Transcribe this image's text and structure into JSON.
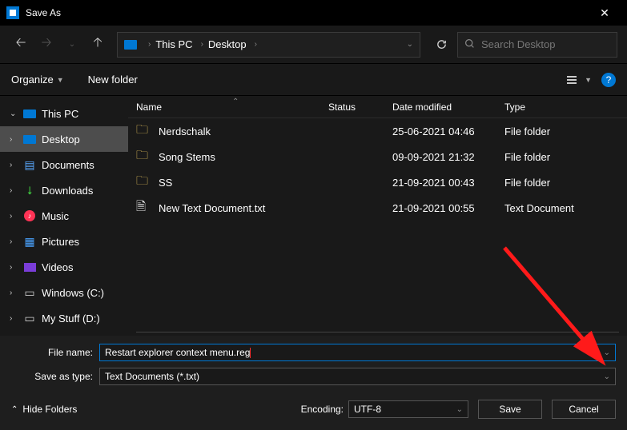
{
  "title": "Save As",
  "breadcrumb": {
    "pc": "This PC",
    "folder": "Desktop"
  },
  "search_placeholder": "Search Desktop",
  "toolbar": {
    "organize": "Organize",
    "new_folder": "New folder"
  },
  "sidebar": [
    {
      "label": "This PC",
      "icon": "pc",
      "caret": "down"
    },
    {
      "label": "Desktop",
      "icon": "desktop",
      "caret": "right",
      "active": true
    },
    {
      "label": "Documents",
      "icon": "doc",
      "caret": "right"
    },
    {
      "label": "Downloads",
      "icon": "down",
      "caret": "right"
    },
    {
      "label": "Music",
      "icon": "music",
      "caret": "right"
    },
    {
      "label": "Pictures",
      "icon": "pic",
      "caret": "right"
    },
    {
      "label": "Videos",
      "icon": "vid",
      "caret": "right"
    },
    {
      "label": "Windows (C:)",
      "icon": "drive",
      "caret": "right"
    },
    {
      "label": "My Stuff (D:)",
      "icon": "drive",
      "caret": "right"
    }
  ],
  "columns": {
    "name": "Name",
    "status": "Status",
    "date": "Date modified",
    "type": "Type"
  },
  "files": [
    {
      "name": "Nerdschalk",
      "date": "25-06-2021 04:46",
      "type": "File folder",
      "kind": "folder"
    },
    {
      "name": "Song Stems",
      "date": "09-09-2021 21:32",
      "type": "File folder",
      "kind": "folder"
    },
    {
      "name": "SS",
      "date": "21-09-2021 00:43",
      "type": "File folder",
      "kind": "folder"
    },
    {
      "name": "New Text Document.txt",
      "date": "21-09-2021 00:55",
      "type": "Text Document",
      "kind": "txt"
    }
  ],
  "labels": {
    "file_name": "File name:",
    "save_type": "Save as type:",
    "encoding": "Encoding:",
    "hide_folders": "Hide Folders",
    "save": "Save",
    "cancel": "Cancel"
  },
  "values": {
    "file_name": "Restart explorer context menu.reg",
    "save_type": "Text Documents (*.txt)",
    "encoding": "UTF-8"
  }
}
